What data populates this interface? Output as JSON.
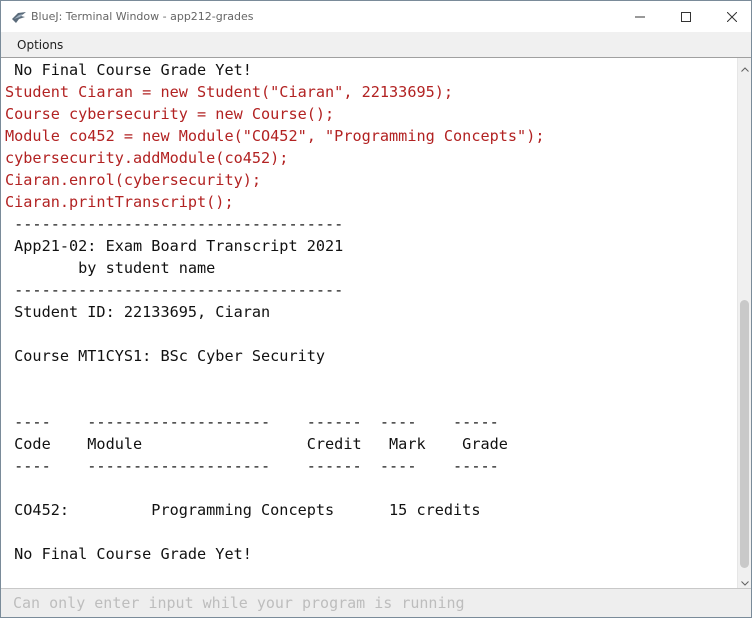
{
  "window": {
    "title": "BlueJ: Terminal Window - app212-grades",
    "app_icon": "bluej-bird-icon"
  },
  "menu": {
    "items": [
      "Options"
    ]
  },
  "terminal": {
    "lines": [
      {
        "text": " No Final Course Grade Yet!",
        "kind": "output"
      },
      {
        "text": "Student Ciaran = new Student(\"Ciaran\", 22133695);",
        "kind": "command"
      },
      {
        "text": "Course cybersecurity = new Course();",
        "kind": "command"
      },
      {
        "text": "Module co452 = new Module(\"CO452\", \"Programming Concepts\");",
        "kind": "command"
      },
      {
        "text": "cybersecurity.addModule(co452);",
        "kind": "command"
      },
      {
        "text": "Ciaran.enrol(cybersecurity);",
        "kind": "command"
      },
      {
        "text": "Ciaran.printTranscript();",
        "kind": "command"
      },
      {
        "text": " ------------------------------------",
        "kind": "output"
      },
      {
        "text": " App21-02: Exam Board Transcript 2021",
        "kind": "output"
      },
      {
        "text": "        by student name",
        "kind": "output"
      },
      {
        "text": " ------------------------------------",
        "kind": "output"
      },
      {
        "text": " Student ID: 22133695, Ciaran",
        "kind": "output"
      },
      {
        "text": "",
        "kind": "output"
      },
      {
        "text": " Course MT1CYS1: BSc Cyber Security",
        "kind": "output"
      },
      {
        "text": "",
        "kind": "output"
      },
      {
        "text": "",
        "kind": "output"
      },
      {
        "text": " ----    --------------------    ------  ----    -----",
        "kind": "output"
      },
      {
        "text": " Code    Module                  Credit   Mark    Grade",
        "kind": "output"
      },
      {
        "text": " ----    --------------------    ------  ----    -----",
        "kind": "output"
      },
      {
        "text": "",
        "kind": "output"
      },
      {
        "text": " CO452:         Programming Concepts      15 credits",
        "kind": "output"
      },
      {
        "text": "",
        "kind": "output"
      },
      {
        "text": " No Final Course Grade Yet!",
        "kind": "output"
      }
    ]
  },
  "input": {
    "placeholder": "Can only enter input while your program is running"
  },
  "colors": {
    "command_text": "#b22222",
    "output_text": "#111111",
    "input_placeholder": "#bdbdbd"
  }
}
